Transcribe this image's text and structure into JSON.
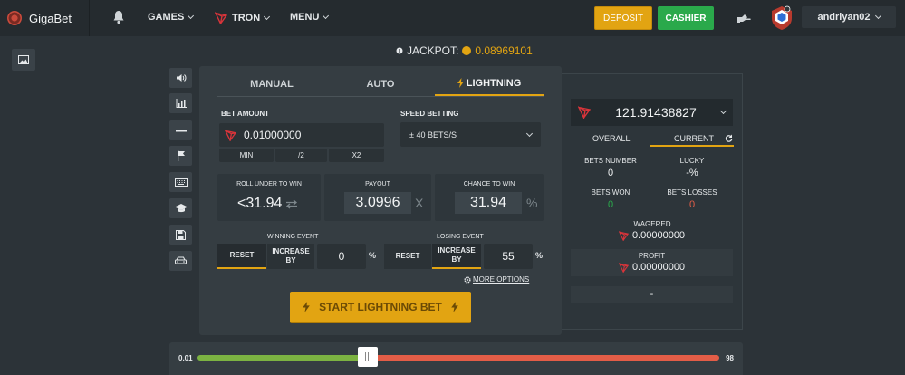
{
  "header": {
    "brand": "GigaBet",
    "nav": [
      {
        "label": "GAMES"
      },
      {
        "label": "TRON"
      },
      {
        "label": "MENU"
      }
    ],
    "deposit_label": "DEPOSIT",
    "cashier_label": "CASHIER",
    "username": "andriyan02"
  },
  "jackpot": {
    "label": "JACKPOT:",
    "value": "0.08969101"
  },
  "tabs": [
    {
      "label": "MANUAL"
    },
    {
      "label": "AUTO"
    },
    {
      "label": "LIGHTNING"
    }
  ],
  "bet": {
    "label": "BET AMOUNT",
    "value": "0.01000000",
    "min_label": "MIN",
    "half_label": "/2",
    "double_label": "X2"
  },
  "speed": {
    "label": "SPEED BETTING",
    "value": "± 40 BETS/S"
  },
  "roll": {
    "label": "ROLL UNDER TO WIN",
    "value": "<31.94"
  },
  "payout": {
    "label": "PAYOUT",
    "value": "3.0996",
    "unit": "X"
  },
  "chance": {
    "label": "CHANCE TO WIN",
    "value": "31.94",
    "unit": "%"
  },
  "winning": {
    "label": "WINNING EVENT",
    "reset": "RESET",
    "increase": "INCREASE BY",
    "value": "0",
    "unit": "%"
  },
  "losing": {
    "label": "LOSING EVENT",
    "reset": "RESET",
    "increase": "INCREASE BY",
    "value": "55",
    "unit": "%"
  },
  "more_options": "MORE OPTIONS",
  "start_button": "START LIGHTNING BET",
  "stats": {
    "balance": "121.91438827",
    "tab_overall": "OVERALL",
    "tab_current": "CURRENT",
    "bets_number_label": "BETS NUMBER",
    "bets_number": "0",
    "lucky_label": "LUCKY",
    "lucky": "-%",
    "bets_won_label": "BETS WON",
    "bets_won": "0",
    "bets_losses_label": "BETS LOSSES",
    "bets_losses": "0",
    "wagered_label": "WAGERED",
    "wagered": "0.00000000",
    "profit_label": "PROFIT",
    "profit": "0.00000000",
    "extra": "-"
  },
  "slider": {
    "min": "0.01",
    "max": "98",
    "value": 31.94
  },
  "colors": {
    "accent": "#e2a412",
    "win": "#2aa94b",
    "loss": "#e35d47",
    "tron": "#d8343a"
  },
  "icons": [
    "bell-icon",
    "tron-icon",
    "sound-icon",
    "chart-icon",
    "minus-icon",
    "flag-icon",
    "keyboard-icon",
    "graduation-icon",
    "save-icon",
    "car-icon",
    "image-icon",
    "lightning-icon",
    "refresh-icon",
    "gear-icon",
    "swap-icon",
    "hand-icon",
    "shield-avatar-icon",
    "coin-icon"
  ]
}
